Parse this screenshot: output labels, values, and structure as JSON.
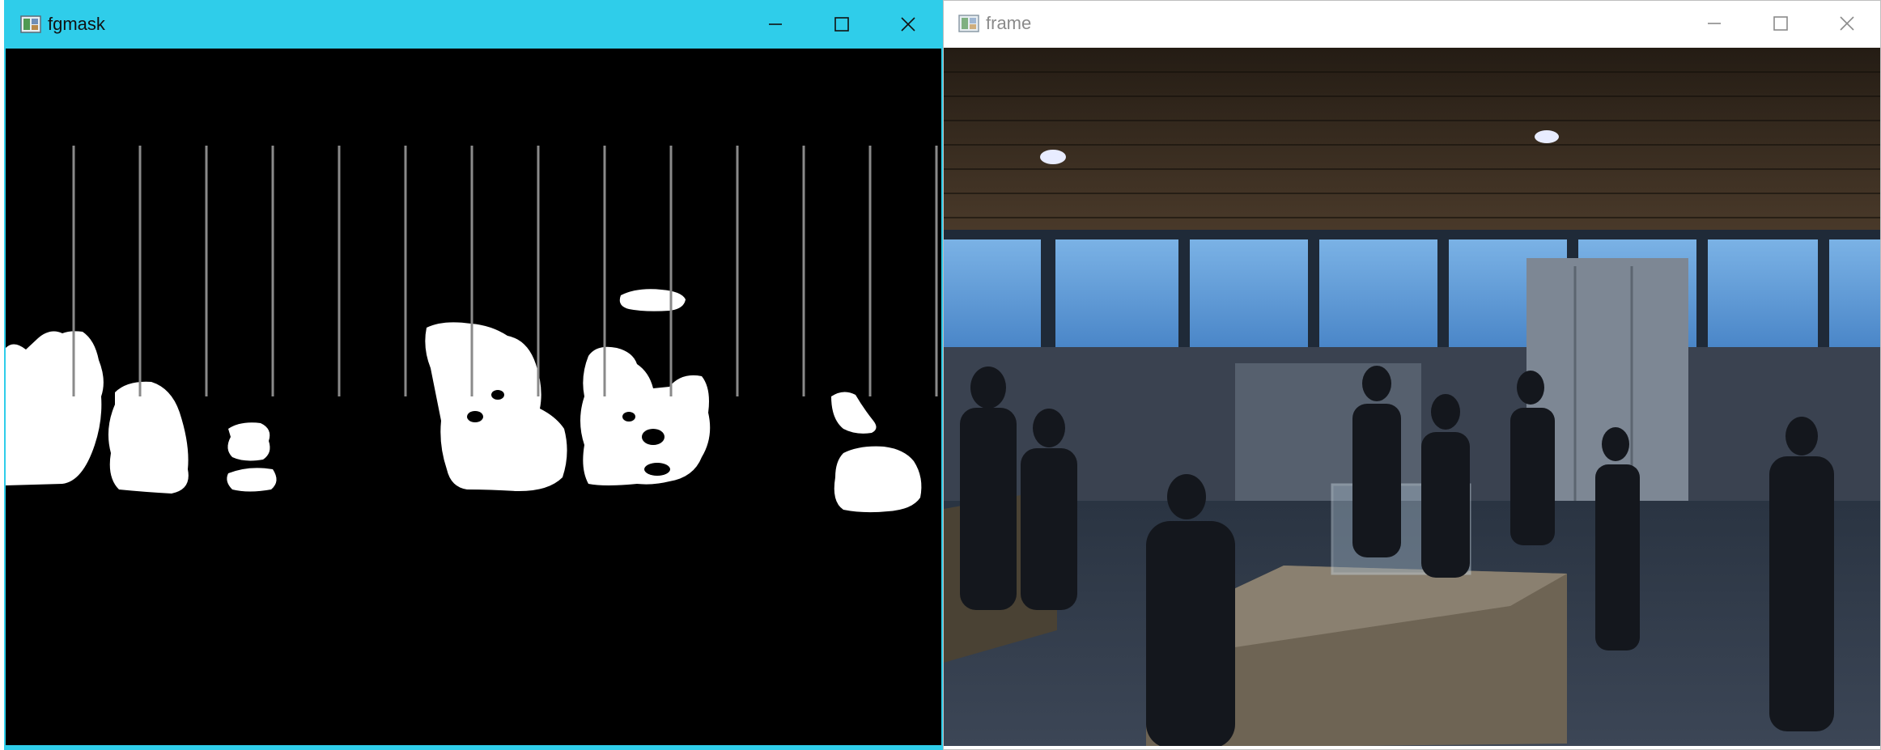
{
  "windows": [
    {
      "title": "fgmask",
      "active": true,
      "controls": [
        "minimize-icon",
        "maximize-icon",
        "close-icon"
      ]
    },
    {
      "title": "frame",
      "active": false,
      "controls": [
        "minimize-icon",
        "maximize-icon",
        "close-icon"
      ]
    }
  ],
  "colors": {
    "active_titlebar": "#2fcdea",
    "mask_foreground": "#ffffff",
    "mask_background": "#000000",
    "guide_line": "#8a8a8a"
  }
}
